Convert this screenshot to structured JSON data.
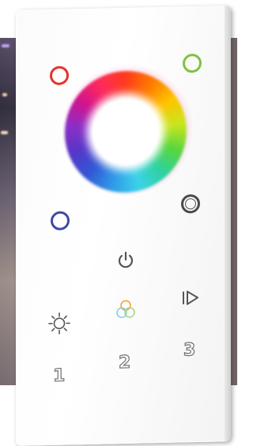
{
  "controller": {
    "corner_dots": [
      {
        "name": "red-ring-button",
        "color": "#e5332a"
      },
      {
        "name": "green-ring-button",
        "color": "#7fc241"
      },
      {
        "name": "blue-ring-button",
        "color": "#3d4aa8"
      },
      {
        "name": "white-ring-button",
        "color": "#555555"
      }
    ],
    "buttons": {
      "power": "power-icon",
      "play": "play-next-icon",
      "brightness": "sun-icon",
      "rgb_mix": "rgb-mix-icon"
    },
    "scene_labels": [
      "1",
      "2",
      "3"
    ]
  }
}
